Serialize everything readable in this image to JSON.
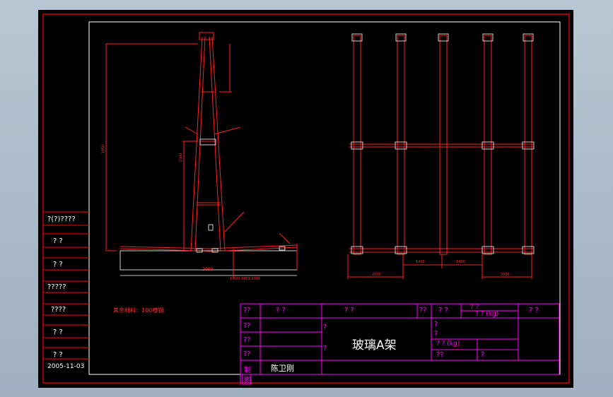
{
  "colors": {
    "background": "#000000",
    "frame": "#ff0000",
    "title_block": "#ff00ff",
    "drawing": "#ff2020",
    "detail": "#ffffff"
  },
  "title_block": {
    "product_name": "玻璃A架",
    "designer": "陈卫刚",
    "weight_label_1": "?  ?  (kg)",
    "weight_label_2": "? ? (kg)",
    "cells": {
      "r1c1": "??",
      "r1c2": "?    ?",
      "r1c3": "?          ?",
      "r1c4": "??",
      "r1c5": "?   ?",
      "r1c6": "?   ?",
      "r1c7": "?   ?",
      "r2c1": "??",
      "r2c2": "?",
      "r2c3": "?",
      "r2c4": "?",
      "r3c1": "??",
      "r3c2": "?",
      "r4c1": "??",
      "r4c2": "??",
      "r4c3": "?",
      "r5c1": "制",
      "r5c2": "图"
    }
  },
  "side_table": {
    "rows": [
      "?(?)????",
      "?    ?",
      "?    ?",
      "?????",
      "????",
      "?    ?",
      "?    ?"
    ],
    "date": "2005-11-03"
  },
  "notes": {
    "material_note": "其余材料：100槽钢"
  },
  "dimensions": {
    "side_width": "2000",
    "bottom_label": "1.000  1001  2000",
    "front_dims": [
      "2000",
      "1400",
      "1400",
      "2000"
    ],
    "height": "1950",
    "vertical_2": "2000"
  }
}
